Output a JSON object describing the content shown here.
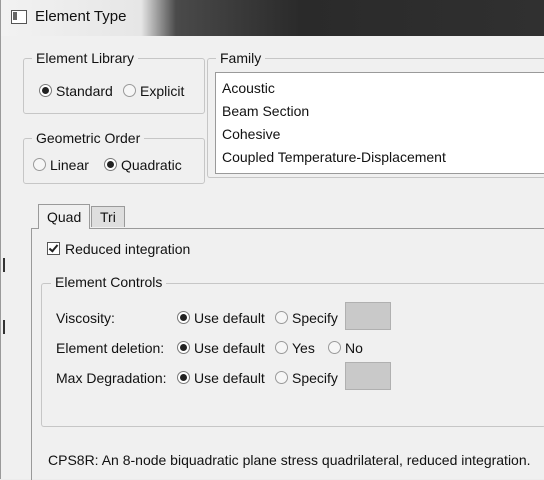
{
  "window": {
    "title": "Element Type"
  },
  "element_library": {
    "label": "Element Library",
    "options": [
      {
        "label": "Standard",
        "selected": true
      },
      {
        "label": "Explicit",
        "selected": false
      }
    ]
  },
  "geometric_order": {
    "label": "Geometric Order",
    "options": [
      {
        "label": "Linear",
        "selected": false
      },
      {
        "label": "Quadratic",
        "selected": true
      }
    ]
  },
  "family": {
    "label": "Family",
    "items": [
      "Acoustic",
      "Beam Section",
      "Cohesive",
      "Coupled Temperature-Displacement"
    ]
  },
  "tabs": [
    {
      "label": "Quad",
      "active": true
    },
    {
      "label": "Tri",
      "active": false
    }
  ],
  "reduced_integration": {
    "label": "Reduced integration",
    "checked": true
  },
  "element_controls": {
    "label": "Element Controls",
    "rows": [
      {
        "label": "Viscosity:",
        "options": [
          "Use default",
          "Specify"
        ],
        "selected": 0
      },
      {
        "label": "Element deletion:",
        "options": [
          "Use default",
          "Yes",
          "No"
        ],
        "selected": 0
      },
      {
        "label": "Max Degradation:",
        "options": [
          "Use default",
          "Specify"
        ],
        "selected": 0
      }
    ]
  },
  "description": "CPS8R:  An 8-node biquadratic plane stress quadrilateral, reduced integration."
}
